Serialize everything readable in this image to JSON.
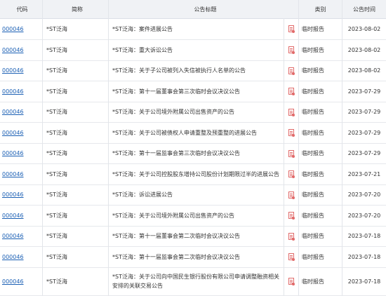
{
  "headers": {
    "code": "代码",
    "name": "简称",
    "title": "公告标题",
    "type": "类别",
    "time": "公告时间"
  },
  "rows": [
    {
      "code": "000046",
      "name": "*ST泛海",
      "title": "*ST泛海：案件进展公告",
      "type": "临时报告",
      "date": "2023-08-02"
    },
    {
      "code": "000046",
      "name": "*ST泛海",
      "title": "*ST泛海：重大诉讼公告",
      "type": "临时报告",
      "date": "2023-08-02"
    },
    {
      "code": "000046",
      "name": "*ST泛海",
      "title": "*ST泛海：关于子公司被列入失信被执行人名单的公告",
      "type": "临时报告",
      "date": "2023-08-02"
    },
    {
      "code": "000046",
      "name": "*ST泛海",
      "title": "*ST泛海：第十一届董事会第三次临时会议决议公告",
      "type": "临时报告",
      "date": "2023-07-29"
    },
    {
      "code": "000046",
      "name": "*ST泛海",
      "title": "*ST泛海：关于公司境外附属公司出售资产的公告",
      "type": "临时报告",
      "date": "2023-07-29"
    },
    {
      "code": "000046",
      "name": "*ST泛海",
      "title": "*ST泛海：关于公司被债权人申请重整及预重整的进展公告",
      "type": "临时报告",
      "date": "2023-07-29"
    },
    {
      "code": "000046",
      "name": "*ST泛海",
      "title": "*ST泛海：第十一届监事会第三次临时会议决议公告",
      "type": "临时报告",
      "date": "2023-07-29"
    },
    {
      "code": "000046",
      "name": "*ST泛海",
      "title": "*ST泛海：关于公司控股股东增持公司股份计划期限过半的进展公告",
      "type": "临时报告",
      "date": "2023-07-21"
    },
    {
      "code": "000046",
      "name": "*ST泛海",
      "title": "*ST泛海：诉讼进展公告",
      "type": "临时报告",
      "date": "2023-07-20"
    },
    {
      "code": "000046",
      "name": "*ST泛海",
      "title": "*ST泛海：关于公司境外附属公司出售资产的公告",
      "type": "临时报告",
      "date": "2023-07-20"
    },
    {
      "code": "000046",
      "name": "*ST泛海",
      "title": "*ST泛海：第十一届董事会第二次临时会议决议公告",
      "type": "临时报告",
      "date": "2023-07-18"
    },
    {
      "code": "000046",
      "name": "*ST泛海",
      "title": "*ST泛海：第十一届监事会第二次临时会议决议公告",
      "type": "临时报告",
      "date": "2023-07-18"
    },
    {
      "code": "000046",
      "name": "*ST泛海",
      "title": "*ST泛海：关于公司向中国民生银行股份有限公司申请调整融资相关安排的关联交易公告",
      "type": "临时报告",
      "date": "2023-07-18"
    }
  ],
  "icons": {
    "pdf": "pdf-file-icon"
  },
  "colors": {
    "link": "#1a5fb4",
    "header_bg": "#f0f2f5",
    "pdf_icon": "#e16a6a"
  }
}
